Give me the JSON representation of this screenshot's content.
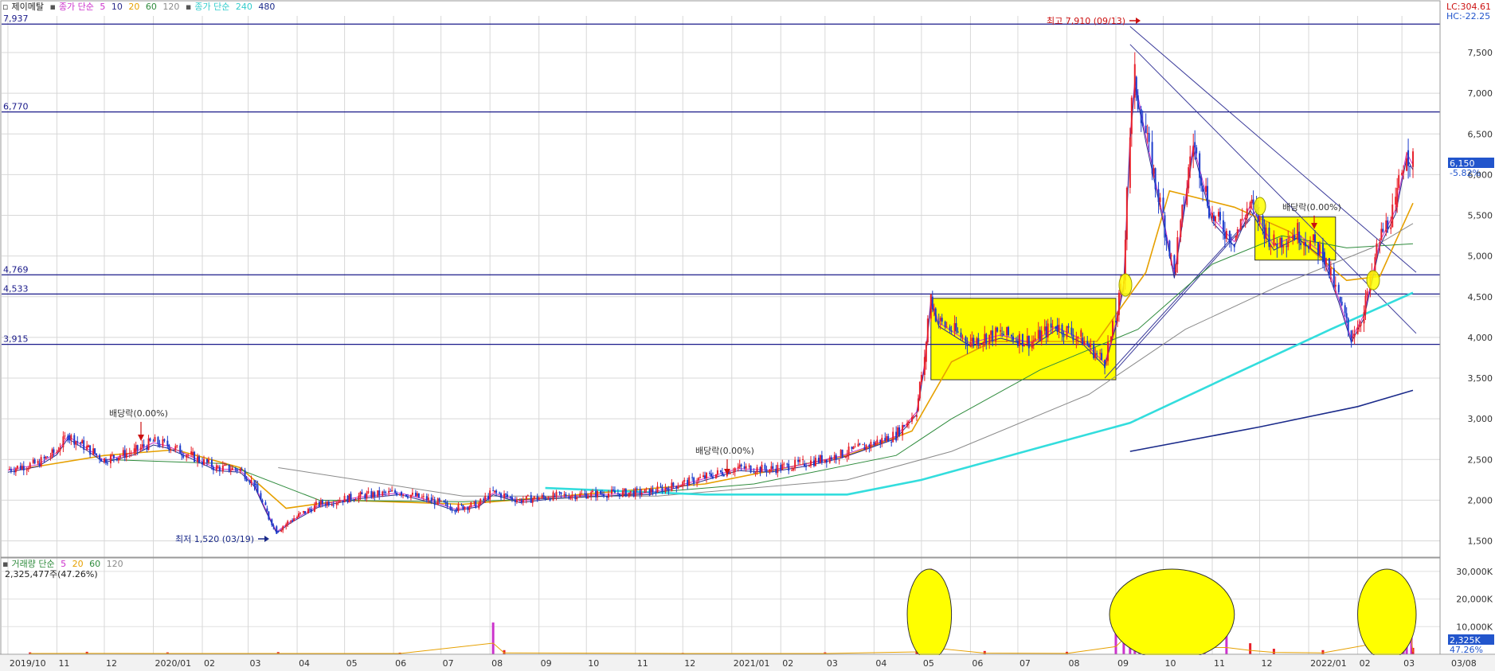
{
  "price_legend": {
    "title": "제이메탈",
    "ma_label": "종가 단순",
    "ma_periods": [
      "5",
      "10",
      "20",
      "60",
      "120"
    ],
    "long_ma_label": "종가 단순",
    "long_ma_periods": [
      "240",
      "480"
    ]
  },
  "volume_legend": {
    "title": "거래량 단순",
    "ma_periods": [
      "5",
      "20",
      "60",
      "120"
    ],
    "current_value": "2,325,477주(47.26%)"
  },
  "top_right": {
    "lc": "LC:304.61",
    "hc": "HC:-22.25"
  },
  "price_badge": {
    "value": "6,150",
    "change": "-5.82%"
  },
  "volume_badge": {
    "value": "2,325K",
    "change": "47.26%"
  },
  "annotations": {
    "high": "최고 7,910 (09/13)",
    "low": "최저 1,520 (03/19)",
    "dividend_1": "배당락(0.00%)",
    "dividend_2": "배당락(0.00%)",
    "dividend_3": "배당락(0.00%)"
  },
  "colors": {
    "up_candle": "#e8202a",
    "down_candle": "#1c3ccc",
    "ma5": "#cc33cc",
    "ma10": "#2a2a8a",
    "ma20": "#e6a000",
    "ma60": "#2e8b3c",
    "ma120": "#8a8a8a",
    "ma240": "#33dddd",
    "ma480": "#1a2a8a",
    "highlight_box": "#ffff00",
    "hline": "#1a1a8a"
  },
  "chart_data": [
    {
      "type": "candlestick",
      "title": "제이메탈",
      "y_axis_ticks": [
        "7,500",
        "7,000",
        "6,500",
        "6,000",
        "5,500",
        "5,000",
        "4,500",
        "4,000",
        "3,500",
        "3,000",
        "2,500",
        "2,000",
        "1,500"
      ],
      "ylim": [
        1300,
        7950
      ],
      "x_labels": [
        "2019/10",
        "11",
        "12",
        "2020/01",
        "02",
        "03",
        "04",
        "05",
        "06",
        "07",
        "08",
        "09",
        "10",
        "11",
        "12",
        "2021/01",
        "02",
        "03",
        "04",
        "05",
        "06",
        "07",
        "08",
        "09",
        "10",
        "11",
        "12",
        "2022/01",
        "02",
        "03",
        "03/08"
      ],
      "horizontal_levels": [
        {
          "label": "7,937",
          "value": 7850
        },
        {
          "label": "6,770",
          "value": 6770
        },
        {
          "label": "4,769",
          "value": 4769
        },
        {
          "label": "4,533",
          "value": 4533
        },
        {
          "label": "3,915",
          "value": 3915
        }
      ],
      "close_path": [
        {
          "d": "2019-10-01",
          "v": 2380
        },
        {
          "d": "2019-10-20",
          "v": 2450
        },
        {
          "d": "2019-11-01",
          "v": 2600
        },
        {
          "d": "2019-11-08",
          "v": 2800
        },
        {
          "d": "2019-11-20",
          "v": 2650
        },
        {
          "d": "2019-12-01",
          "v": 2500
        },
        {
          "d": "2019-12-20",
          "v": 2600
        },
        {
          "d": "2020-01-01",
          "v": 2720
        },
        {
          "d": "2020-01-10",
          "v": 2680
        },
        {
          "d": "2020-01-25",
          "v": 2550
        },
        {
          "d": "2020-02-10",
          "v": 2400
        },
        {
          "d": "2020-02-25",
          "v": 2380
        },
        {
          "d": "2020-03-05",
          "v": 2200
        },
        {
          "d": "2020-03-12",
          "v": 1900
        },
        {
          "d": "2020-03-19",
          "v": 1620
        },
        {
          "d": "2020-03-28",
          "v": 1750
        },
        {
          "d": "2020-04-15",
          "v": 1950
        },
        {
          "d": "2020-05-10",
          "v": 2050
        },
        {
          "d": "2020-06-05",
          "v": 2100
        },
        {
          "d": "2020-06-25",
          "v": 2000
        },
        {
          "d": "2020-07-10",
          "v": 1900
        },
        {
          "d": "2020-07-25",
          "v": 1950
        },
        {
          "d": "2020-08-03",
          "v": 2100
        },
        {
          "d": "2020-08-20",
          "v": 2000
        },
        {
          "d": "2020-09-10",
          "v": 2050
        },
        {
          "d": "2020-10-10",
          "v": 2080
        },
        {
          "d": "2020-11-10",
          "v": 2100
        },
        {
          "d": "2020-12-10",
          "v": 2250
        },
        {
          "d": "2021-01-05",
          "v": 2400
        },
        {
          "d": "2021-01-25",
          "v": 2380
        },
        {
          "d": "2021-02-15",
          "v": 2450
        },
        {
          "d": "2021-03-10",
          "v": 2550
        },
        {
          "d": "2021-03-25",
          "v": 2650
        },
        {
          "d": "2021-04-15",
          "v": 2800
        },
        {
          "d": "2021-04-28",
          "v": 3100
        },
        {
          "d": "2021-05-03",
          "v": 3700
        },
        {
          "d": "2021-05-07",
          "v": 4500
        },
        {
          "d": "2021-05-12",
          "v": 4200
        },
        {
          "d": "2021-06-01",
          "v": 3950
        },
        {
          "d": "2021-06-20",
          "v": 4050
        },
        {
          "d": "2021-07-10",
          "v": 3950
        },
        {
          "d": "2021-07-25",
          "v": 4150
        },
        {
          "d": "2021-08-10",
          "v": 4000
        },
        {
          "d": "2021-08-25",
          "v": 3700
        },
        {
          "d": "2021-09-01",
          "v": 4200
        },
        {
          "d": "2021-09-06",
          "v": 4700
        },
        {
          "d": "2021-09-10",
          "v": 6500
        },
        {
          "d": "2021-09-13",
          "v": 7200
        },
        {
          "d": "2021-09-20",
          "v": 6500
        },
        {
          "d": "2021-10-01",
          "v": 5500
        },
        {
          "d": "2021-10-08",
          "v": 4800
        },
        {
          "d": "2021-10-20",
          "v": 6400
        },
        {
          "d": "2021-11-01",
          "v": 5500
        },
        {
          "d": "2021-11-15",
          "v": 5200
        },
        {
          "d": "2021-11-25",
          "v": 5650
        },
        {
          "d": "2021-12-10",
          "v": 5150
        },
        {
          "d": "2021-12-25",
          "v": 5300
        },
        {
          "d": "2022-01-10",
          "v": 5050
        },
        {
          "d": "2022-01-20",
          "v": 4500
        },
        {
          "d": "2022-01-28",
          "v": 4000
        },
        {
          "d": "2022-02-05",
          "v": 4300
        },
        {
          "d": "2022-02-15",
          "v": 5200
        },
        {
          "d": "2022-02-25",
          "v": 5600
        },
        {
          "d": "2022-03-04",
          "v": 6300
        },
        {
          "d": "2022-03-08",
          "v": 6150
        }
      ],
      "moving_averages": [
        {
          "name": "20",
          "points": [
            {
              "d": "2019-10-15",
              "v": 2400
            },
            {
              "d": "2019-12-01",
              "v": 2550
            },
            {
              "d": "2020-01-15",
              "v": 2620
            },
            {
              "d": "2020-02-25",
              "v": 2400
            },
            {
              "d": "2020-03-25",
              "v": 1900
            },
            {
              "d": "2020-05-01",
              "v": 2000
            },
            {
              "d": "2020-07-15",
              "v": 1950
            },
            {
              "d": "2020-09-15",
              "v": 2050
            },
            {
              "d": "2020-12-15",
              "v": 2200
            },
            {
              "d": "2021-03-15",
              "v": 2550
            },
            {
              "d": "2021-04-25",
              "v": 2850
            },
            {
              "d": "2021-05-20",
              "v": 3700
            },
            {
              "d": "2021-06-15",
              "v": 3950
            },
            {
              "d": "2021-08-20",
              "v": 3950
            },
            {
              "d": "2021-09-20",
              "v": 4800
            },
            {
              "d": "2021-10-05",
              "v": 5800
            },
            {
              "d": "2021-11-15",
              "v": 5600
            },
            {
              "d": "2021-12-20",
              "v": 5300
            },
            {
              "d": "2022-01-25",
              "v": 4700
            },
            {
              "d": "2022-02-15",
              "v": 4750
            },
            {
              "d": "2022-03-08",
              "v": 5650
            }
          ]
        },
        {
          "name": "60",
          "points": [
            {
              "d": "2019-12-01",
              "v": 2500
            },
            {
              "d": "2020-02-15",
              "v": 2450
            },
            {
              "d": "2020-04-15",
              "v": 2000
            },
            {
              "d": "2020-07-15",
              "v": 1980
            },
            {
              "d": "2020-10-15",
              "v": 2050
            },
            {
              "d": "2021-01-15",
              "v": 2200
            },
            {
              "d": "2021-04-15",
              "v": 2550
            },
            {
              "d": "2021-05-20",
              "v": 3000
            },
            {
              "d": "2021-07-15",
              "v": 3600
            },
            {
              "d": "2021-09-15",
              "v": 4100
            },
            {
              "d": "2021-11-01",
              "v": 4900
            },
            {
              "d": "2021-12-15",
              "v": 5250
            },
            {
              "d": "2022-01-25",
              "v": 5100
            },
            {
              "d": "2022-03-08",
              "v": 5150
            }
          ]
        },
        {
          "name": "120",
          "points": [
            {
              "d": "2020-03-20",
              "v": 2400
            },
            {
              "d": "2020-07-15",
              "v": 2050
            },
            {
              "d": "2020-11-15",
              "v": 2050
            },
            {
              "d": "2021-03-15",
              "v": 2250
            },
            {
              "d": "2021-05-20",
              "v": 2600
            },
            {
              "d": "2021-08-15",
              "v": 3300
            },
            {
              "d": "2021-10-15",
              "v": 4100
            },
            {
              "d": "2021-12-15",
              "v": 4650
            },
            {
              "d": "2022-02-10",
              "v": 5100
            },
            {
              "d": "2022-03-08",
              "v": 5400
            }
          ]
        },
        {
          "name": "240",
          "points": [
            {
              "d": "2020-09-05",
              "v": 2150
            },
            {
              "d": "2020-12-15",
              "v": 2070
            },
            {
              "d": "2021-03-15",
              "v": 2070
            },
            {
              "d": "2021-05-01",
              "v": 2250
            },
            {
              "d": "2021-07-15",
              "v": 2650
            },
            {
              "d": "2021-09-10",
              "v": 2950
            },
            {
              "d": "2021-11-15",
              "v": 3550
            },
            {
              "d": "2022-01-15",
              "v": 4100
            },
            {
              "d": "2022-03-08",
              "v": 4550
            }
          ]
        },
        {
          "name": "480",
          "points": [
            {
              "d": "2021-09-10",
              "v": 2600
            },
            {
              "d": "2021-12-01",
              "v": 2900
            },
            {
              "d": "2022-02-01",
              "v": 3150
            },
            {
              "d": "2022-03-08",
              "v": 3350
            }
          ]
        }
      ],
      "boxes": [
        {
          "from": "2021-05-07",
          "to": "2021-09-01",
          "low": 3480,
          "high": 4480
        },
        {
          "from": "2021-11-28",
          "to": "2022-01-18",
          "low": 4950,
          "high": 5480
        }
      ]
    },
    {
      "type": "bar",
      "title": "거래량 단순",
      "y_axis_ticks": [
        "30,000K",
        "20,000K",
        "10,000K"
      ],
      "ylim": [
        0,
        34000
      ],
      "unit": "K",
      "bars": [
        {
          "d": "2019-10-15",
          "v": 700
        },
        {
          "d": "2019-11-20",
          "v": 900
        },
        {
          "d": "2020-01-10",
          "v": 700
        },
        {
          "d": "2020-03-20",
          "v": 800
        },
        {
          "d": "2020-06-05",
          "v": 600
        },
        {
          "d": "2020-08-03",
          "v": 11500
        },
        {
          "d": "2020-08-10",
          "v": 1500
        },
        {
          "d": "2020-12-01",
          "v": 500
        },
        {
          "d": "2021-03-01",
          "v": 700
        },
        {
          "d": "2021-04-28",
          "v": 2500
        },
        {
          "d": "2021-05-03",
          "v": 9000
        },
        {
          "d": "2021-05-06",
          "v": 13000
        },
        {
          "d": "2021-05-07",
          "v": 31000
        },
        {
          "d": "2021-05-10",
          "v": 26000
        },
        {
          "d": "2021-05-12",
          "v": 6000
        },
        {
          "d": "2021-06-10",
          "v": 1200
        },
        {
          "d": "2021-08-01",
          "v": 900
        },
        {
          "d": "2021-09-01",
          "v": 8000
        },
        {
          "d": "2021-09-06",
          "v": 16000
        },
        {
          "d": "2021-09-10",
          "v": 14000
        },
        {
          "d": "2021-09-13",
          "v": 23000
        },
        {
          "d": "2021-09-16",
          "v": 21000
        },
        {
          "d": "2021-09-24",
          "v": 12000
        },
        {
          "d": "2021-10-05",
          "v": 17000
        },
        {
          "d": "2021-10-13",
          "v": 8000
        },
        {
          "d": "2021-10-20",
          "v": 18000
        },
        {
          "d": "2021-10-27",
          "v": 7000
        },
        {
          "d": "2021-11-10",
          "v": 7000
        },
        {
          "d": "2021-11-25",
          "v": 4000
        },
        {
          "d": "2021-12-10",
          "v": 2000
        },
        {
          "d": "2022-01-10",
          "v": 1500
        },
        {
          "d": "2022-02-15",
          "v": 12000
        },
        {
          "d": "2022-02-20",
          "v": 6000
        },
        {
          "d": "2022-02-25",
          "v": 17000
        },
        {
          "d": "2022-03-02",
          "v": 14000
        },
        {
          "d": "2022-03-04",
          "v": 22000
        },
        {
          "d": "2022-03-07",
          "v": 16000
        },
        {
          "d": "2022-03-08",
          "v": 2325
        }
      ],
      "highlights": [
        {
          "from": "2021-04-22",
          "to": "2021-05-20"
        },
        {
          "from": "2021-08-28",
          "to": "2021-11-15"
        },
        {
          "from": "2022-02-01",
          "to": "2022-03-10"
        }
      ]
    }
  ]
}
